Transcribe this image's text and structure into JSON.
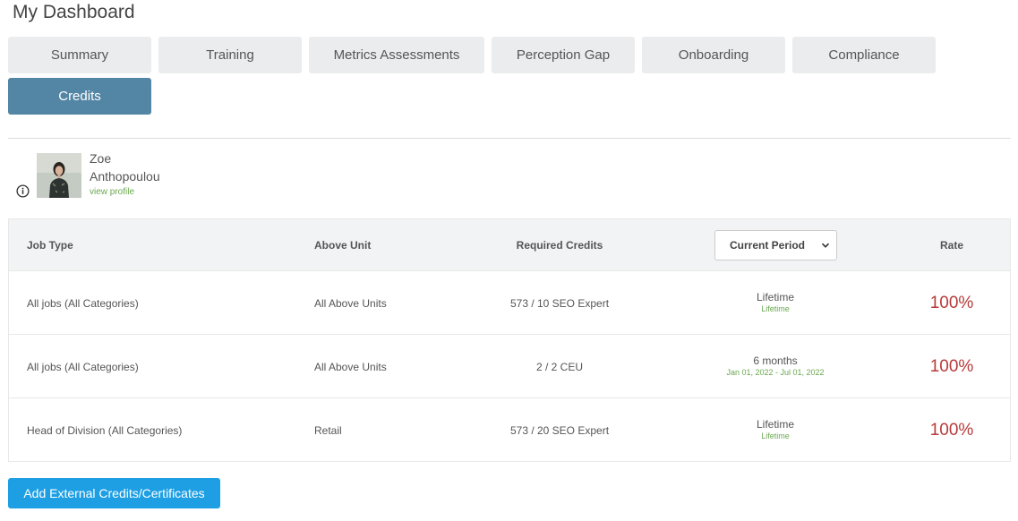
{
  "page": {
    "title": "My Dashboard"
  },
  "tabs": [
    {
      "label": "Summary"
    },
    {
      "label": "Training"
    },
    {
      "label": "Metrics Assessments"
    },
    {
      "label": "Perception Gap"
    },
    {
      "label": "Onboarding"
    },
    {
      "label": "Compliance"
    },
    {
      "label": "Credits",
      "active": true
    }
  ],
  "user": {
    "first_name": "Zoe",
    "last_name": "Anthopoulou",
    "profile_link": "view profile"
  },
  "table": {
    "headers": {
      "job_type": "Job Type",
      "above_unit": "Above Unit",
      "required_credits": "Required Credits",
      "period_select": "Current Period",
      "rate": "Rate"
    },
    "rows": [
      {
        "job_type": "All jobs (All Categories)",
        "above_unit": "All Above Units",
        "required_credits": "573 / 10 SEO Expert",
        "period": "Lifetime",
        "period_detail": "Lifetime",
        "rate": "100%"
      },
      {
        "job_type": "All jobs (All Categories)",
        "above_unit": "All Above Units",
        "required_credits": "2 / 2 CEU",
        "period": "6 months",
        "period_detail": "Jan 01, 2022 - Jul 01, 2022",
        "rate": "100%"
      },
      {
        "job_type": "Head of Division (All Categories)",
        "above_unit": "Retail",
        "required_credits": "573 / 20 SEO Expert",
        "period": "Lifetime",
        "period_detail": "Lifetime",
        "rate": "100%"
      }
    ]
  },
  "actions": {
    "add_external": "Add External Credits/Certificates"
  },
  "colors": {
    "active_tab": "#5385a4",
    "tab_bg": "#ebecee",
    "primary_button": "#1e9fe4",
    "rate_text": "#b83a3a",
    "link_green": "#6aa84f"
  },
  "icons": {
    "info": "info-icon",
    "dropdown": "chevron-down-icon"
  }
}
